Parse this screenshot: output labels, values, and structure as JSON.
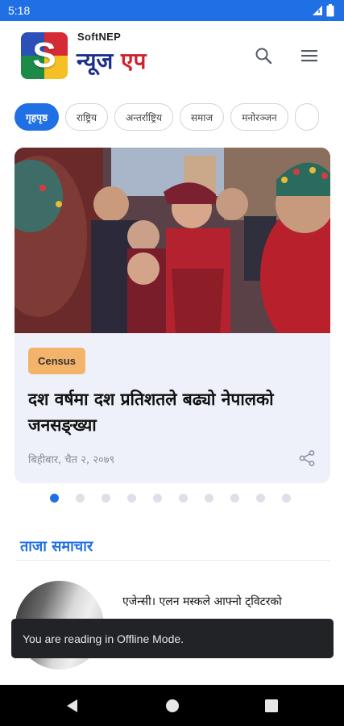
{
  "status_bar": {
    "time": "5:18"
  },
  "header": {
    "logo_letter": "S",
    "brand_small": "SoftNEP",
    "brand_word1": "न्यूज",
    "brand_word2": "एप",
    "icons": [
      "search-icon",
      "menu-icon"
    ]
  },
  "categories": [
    "गृहपृष्ठ",
    "राष्ट्रिय",
    "अन्तर्राष्ट्रिय",
    "समाज",
    "मनोरञ्जन"
  ],
  "featured": {
    "badge": "Census",
    "headline": "दश वर्षमा दश प्रतिशतले बढ्यो नेपालको जनसङ्ख्या",
    "date": "बिहीबार, चैत २, २०७९"
  },
  "carousel": {
    "total": 10,
    "active": 1
  },
  "latest": {
    "title": "ताजा समाचार",
    "first_item_title": "एजेन्सी। एलन मस्कले आफ्नो ट्विटरको"
  },
  "toast": "You are reading in Offline Mode.",
  "colors": {
    "primary": "#1f6fe5",
    "brand_red": "#d11f2d",
    "brand_navy": "#1c2f8c",
    "badge": "#f3b36b"
  }
}
